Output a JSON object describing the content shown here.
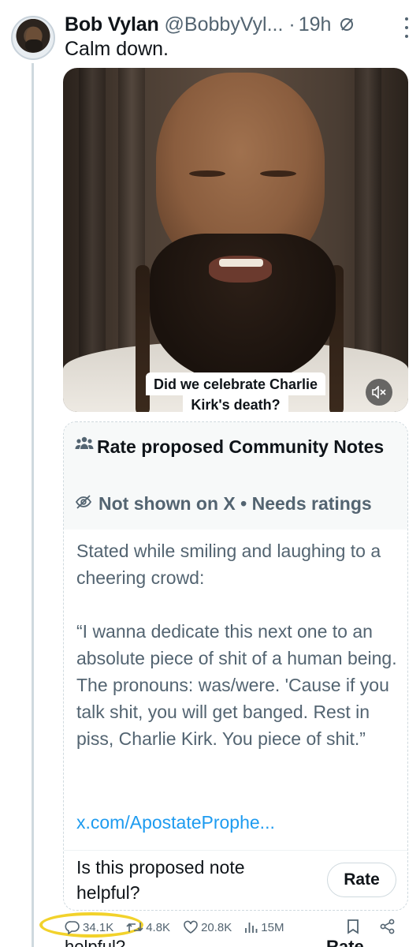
{
  "post": {
    "author_name": "Bob Vylan",
    "author_handle": "@BobbyVyl...",
    "separator": "·",
    "time": "19h",
    "text": "Calm down."
  },
  "media": {
    "caption_line1": "Did we celebrate Charlie",
    "caption_line2": "Kirk's death?",
    "mute_icon": "volume-muted-icon"
  },
  "community_note": {
    "title": "Rate proposed Community Notes",
    "status": "Not shown on X • Needs ratings",
    "body_paragraphs": [
      "Stated while smiling and laughing to a cheering crowd:",
      "“I wanna dedicate this next one to an absolute piece of shit of a human being. The pronouns: was/were. 'Cause if you talk shit, you will get banged. Rest in piss, Charlie Kirk. You piece of shit.”"
    ],
    "link": "x.com/ApostateProphe...",
    "question": "Is this proposed note helpful?",
    "rate_label": "Rate"
  },
  "actions": {
    "replies": "34.1K",
    "reposts": "4.8K",
    "likes": "20.8K",
    "views": "15M"
  },
  "cut_off": {
    "left": "helpful?",
    "right": "Rate"
  },
  "colors": {
    "text": "#0f1419",
    "secondary": "#536471",
    "link": "#1d9bf0",
    "highlight": "#f2d22b"
  }
}
